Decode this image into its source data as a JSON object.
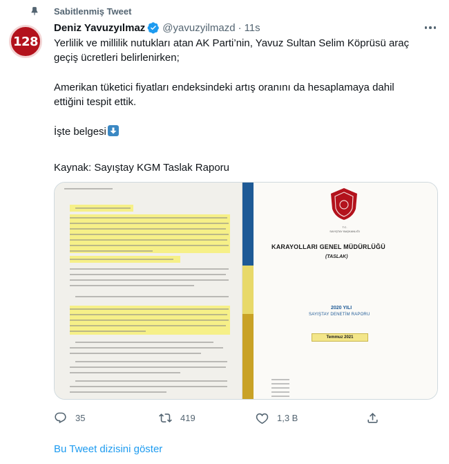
{
  "pinned": {
    "label": "Sabitlenmiş Tweet"
  },
  "author": {
    "avatar_text": "128",
    "display_name": "Deniz Yavuzyılmaz",
    "handle": "@yavuzyilmazd",
    "separator": "·",
    "time": "11s"
  },
  "tweet": {
    "paragraphs": [
      "Yerlilik ve millilik nutukları atan AK Parti’nin, Yavuz Sultan Selim Köprüsü araç geçiş ücretleri belirlenirken;",
      "Amerikan tüketici fiyatları endeksindeki artış oranını da hesaplamaya dahil ettiğini tespit ettik.",
      "İşte belgesi",
      "Kaynak: Sayıştay KGM Taslak Raporu"
    ]
  },
  "media": {
    "report": {
      "tc": "T.C.",
      "institution": "SAYIŞTAY BAŞKANLIĞI",
      "title": "KARAYOLLARI GENEL MÜDÜRLÜĞÜ",
      "draft": "(TASLAK)",
      "year": "2020 YILI",
      "report_name": "SAYIŞTAY DENETİM RAPORU",
      "date": "Temmuz 2021"
    }
  },
  "actions": {
    "reply_count": "35",
    "retweet_count": "419",
    "like_count": "1,3 B"
  },
  "show_thread": "Bu Tweet dizisini göster",
  "colors": {
    "accent": "#1d9bf0",
    "muted": "#536471",
    "avatar": "#b3121c",
    "highlight": "#f6ef7d"
  }
}
